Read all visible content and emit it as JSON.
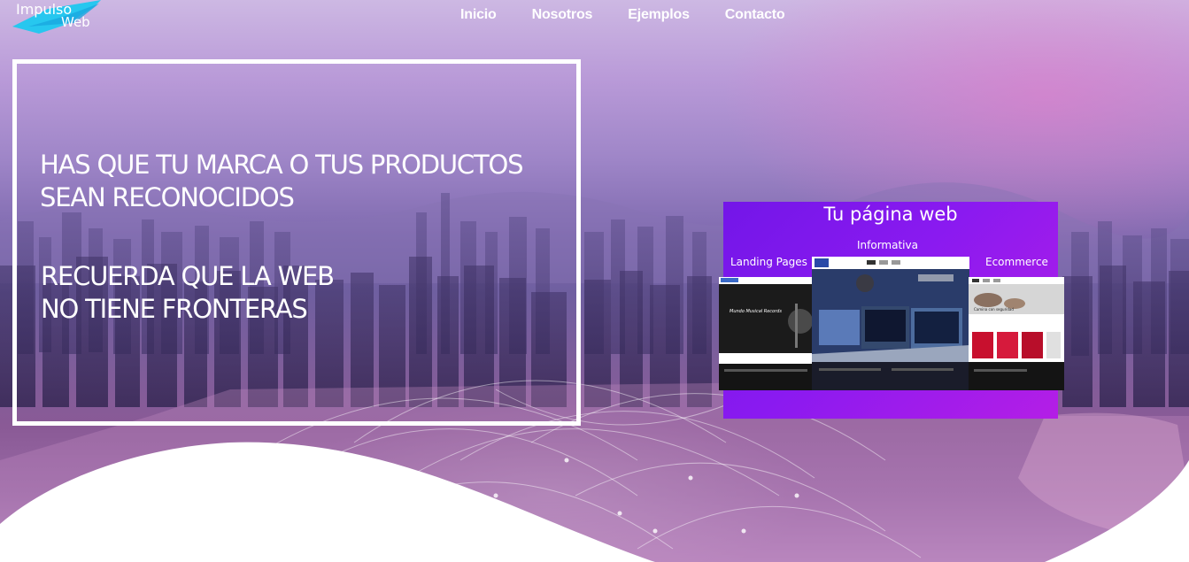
{
  "brand": {
    "line1": "Impulso",
    "line2": "Web"
  },
  "nav": {
    "items": [
      {
        "label": "Inicio"
      },
      {
        "label": "Nosotros"
      },
      {
        "label": "Ejemplos"
      },
      {
        "label": "Contacto"
      }
    ]
  },
  "hero": {
    "headline_1": "HAS QUE TU MARCA O TUS PRODUCTOS",
    "headline_2": "SEAN RECONOCIDOS",
    "headline_3": "RECUERDA QUE LA WEB",
    "headline_4": "NO TIENE FRONTERAS"
  },
  "promo": {
    "title": "Tu página web",
    "type_center": "Informativa",
    "type_left": "Landing Pages",
    "type_right": "Ecommerce",
    "thumb_left_text": "Mundo Musical Records",
    "thumb_right_text": "Camina con seguridad"
  },
  "colors": {
    "promo_bg": "#7316e8",
    "promo_bg_end": "#b41ee6",
    "nav_text": "#ffffff",
    "wave": "#ffffff"
  }
}
